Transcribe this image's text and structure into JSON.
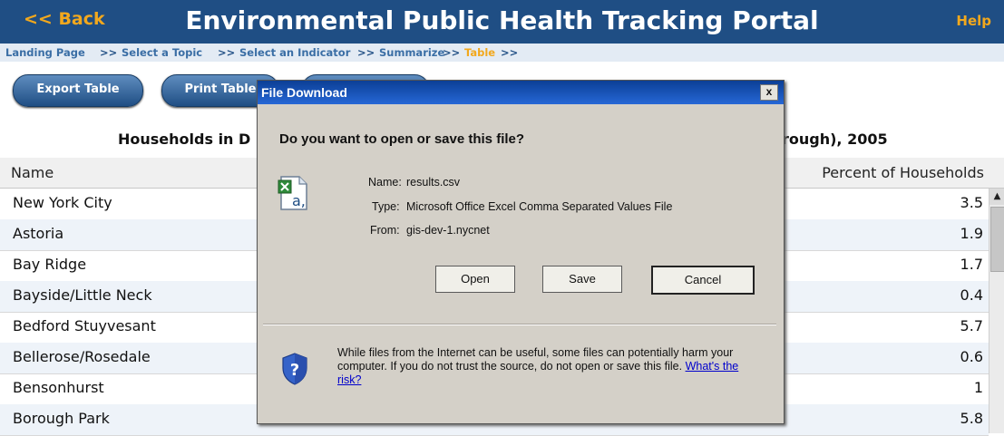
{
  "header": {
    "back_label": "<< Back",
    "title": "Environmental Public Health Tracking Portal",
    "help_label": "Help"
  },
  "breadcrumb": {
    "items": [
      "Landing Page",
      "Select a Topic",
      "Select an Indicator",
      "Summarize",
      "Table"
    ],
    "separators": [
      ">>",
      ">>",
      ">>",
      ">>",
      ">>"
    ]
  },
  "toolbar": {
    "export_label": "Export Table",
    "print_label": "Print Table"
  },
  "caption": {
    "left": "Households in D",
    "right": "rough), 2005"
  },
  "table": {
    "columns": [
      "Name",
      "Percent of Households"
    ],
    "rows": [
      {
        "name": "New York City",
        "percent": "3.5"
      },
      {
        "name": "Astoria",
        "percent": "1.9"
      },
      {
        "name": "Bay Ridge",
        "percent": "1.7"
      },
      {
        "name": "Bayside/Little Neck",
        "percent": "0.4"
      },
      {
        "name": "Bedford Stuyvesant",
        "percent": "5.7"
      },
      {
        "name": "Bellerose/Rosedale",
        "percent": "0.6"
      },
      {
        "name": "Bensonhurst",
        "percent": "1"
      },
      {
        "name": "Borough Park",
        "percent": "5.8"
      }
    ]
  },
  "dialog": {
    "title": "File Download",
    "question": "Do you want to open or save this file?",
    "name_label": "Name:",
    "name_value": "results.csv",
    "type_label": "Type:",
    "type_value": "Microsoft Office Excel Comma Separated Values File",
    "from_label": "From:",
    "from_value": "gis-dev-1.nycnet",
    "open_label": "Open",
    "save_label": "Save",
    "cancel_label": "Cancel",
    "warning_text": "While files from the Internet can be useful, some files can potentially harm your computer. If you do not trust the source, do not open or save this file.",
    "risk_link": "What's the risk?",
    "close_glyph": "x"
  },
  "colors": {
    "header_bg": "#1f4e84",
    "accent": "#f2a81d",
    "dialog_title": "#0b3f96"
  },
  "icons": [
    "file-csv-icon",
    "security-shield-icon",
    "close-icon",
    "scroll-up-icon"
  ]
}
